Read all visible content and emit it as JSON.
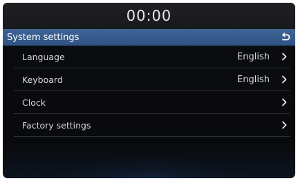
{
  "status_bar": {
    "time": "00:00"
  },
  "header": {
    "title": "System settings",
    "back_icon": "back-arrow-icon"
  },
  "settings": {
    "items": [
      {
        "label": "Language",
        "value": "English"
      },
      {
        "label": "Keyboard",
        "value": "English"
      },
      {
        "label": "Clock",
        "value": ""
      },
      {
        "label": "Factory settings",
        "value": ""
      }
    ]
  },
  "colors": {
    "header_blue": "#3a5f91",
    "background": "#0a0b0e",
    "text": "#d6d8dc"
  }
}
